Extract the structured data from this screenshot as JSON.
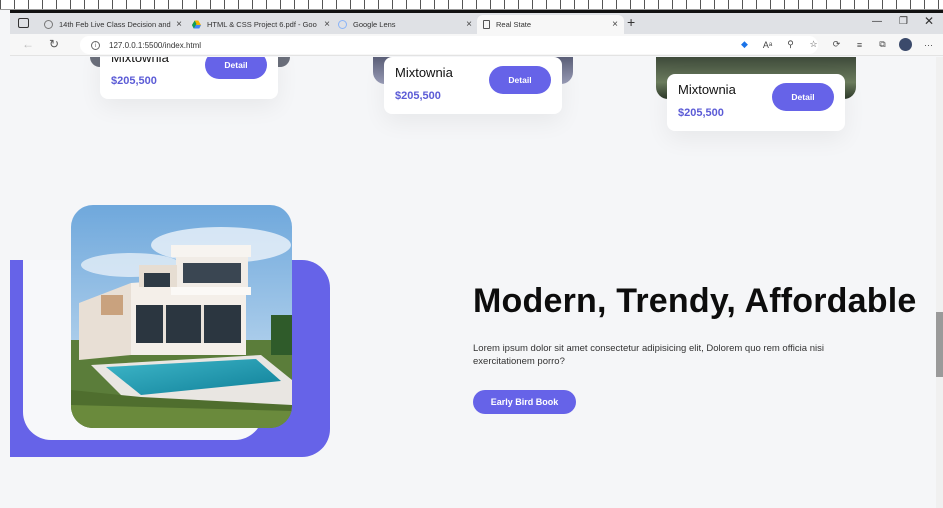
{
  "browser": {
    "tabs": [
      {
        "label": "14th Feb Live Class Decision and",
        "active": false
      },
      {
        "label": "HTML & CSS Project 6.pdf - Goo",
        "active": false
      },
      {
        "label": "Google Lens",
        "active": false
      },
      {
        "label": "Real State",
        "active": true
      }
    ],
    "url": "127.0.0.1:5500/index.html"
  },
  "listing_cards": [
    {
      "name": "Mixtownia",
      "price": "$205,500",
      "button": "Detail"
    },
    {
      "name": "Mixtownia",
      "price": "$205,500",
      "button": "Detail"
    },
    {
      "name": "Mixtownia",
      "price": "$205,500",
      "button": "Detail"
    }
  ],
  "hero": {
    "heading": "Modern, Trendy, Affordable",
    "description": "Lorem ipsum dolor sit amet consectetur adipisicing elit, Dolorem quo rem officia nisi exercitationem porro?",
    "cta": "Early Bird Book"
  },
  "colors": {
    "accent": "#6663e8",
    "price": "#5b5bd6",
    "background": "#f5f6f8"
  }
}
